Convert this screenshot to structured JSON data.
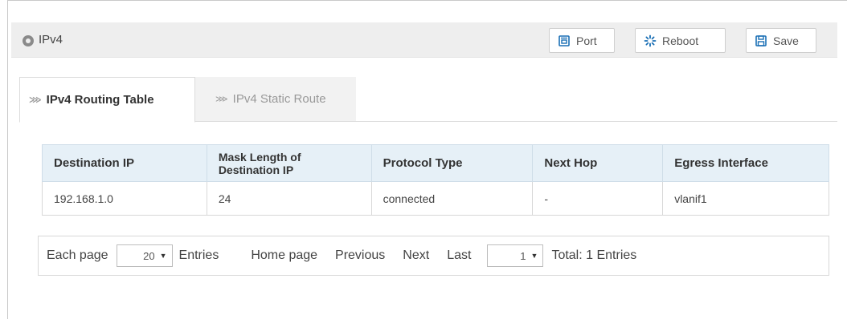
{
  "header": {
    "title": "IPv4",
    "buttons": {
      "port": "Port",
      "reboot": "Reboot",
      "save": "Save"
    }
  },
  "tabs": [
    {
      "label": "IPv4 Routing Table",
      "active": true
    },
    {
      "label": "IPv4 Static Route",
      "active": false
    }
  ],
  "table": {
    "columns": [
      "Destination IP",
      "Mask Length of Destination IP",
      "Protocol Type",
      "Next Hop",
      "Egress Interface"
    ],
    "rows": [
      [
        "192.168.1.0",
        "24",
        "connected",
        "-",
        "vlanif1"
      ]
    ]
  },
  "pager": {
    "each_page_label": "Each page",
    "page_size": "20",
    "entries_label": "Entries",
    "home_page": "Home page",
    "previous": "Previous",
    "next": "Next",
    "last": "Last",
    "current_page": "1",
    "total": "Total: 1 Entries"
  },
  "colors": {
    "accent": "#1a6fb5",
    "header_bg": "#e6f0f7",
    "titlebar_bg": "#eeeeee"
  }
}
